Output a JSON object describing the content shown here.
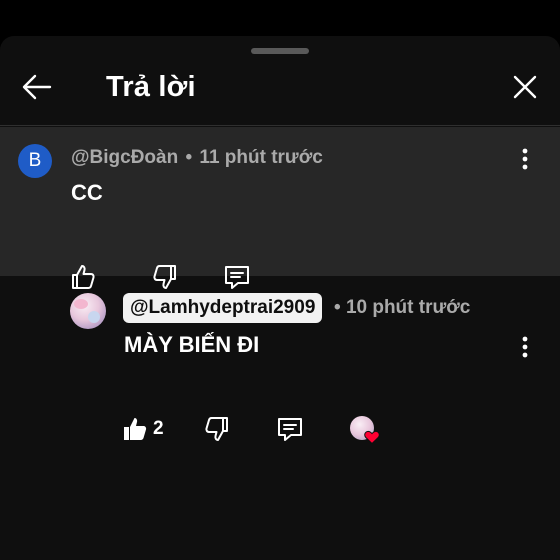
{
  "header": {
    "title": "Trả lời",
    "back_icon": "arrow-left-icon",
    "close_icon": "close-icon"
  },
  "parent_comment": {
    "avatar_letter": "B",
    "avatar_color": "#1f5cc7",
    "author": "@BigcĐoàn",
    "separator": "•",
    "time": "11 phút trước",
    "text": "CC"
  },
  "reply": {
    "author": "@Lamhydeptrai2909",
    "separator": "•",
    "time": "10 phút trước",
    "text": "MÀY BIẾN ĐI",
    "like_count": "2",
    "creator_heart": true,
    "heart_color": "#ff0033"
  },
  "colors": {
    "background": "#0f0f0f",
    "highlight": "#272727",
    "secondary_text": "#aaaaaa"
  }
}
